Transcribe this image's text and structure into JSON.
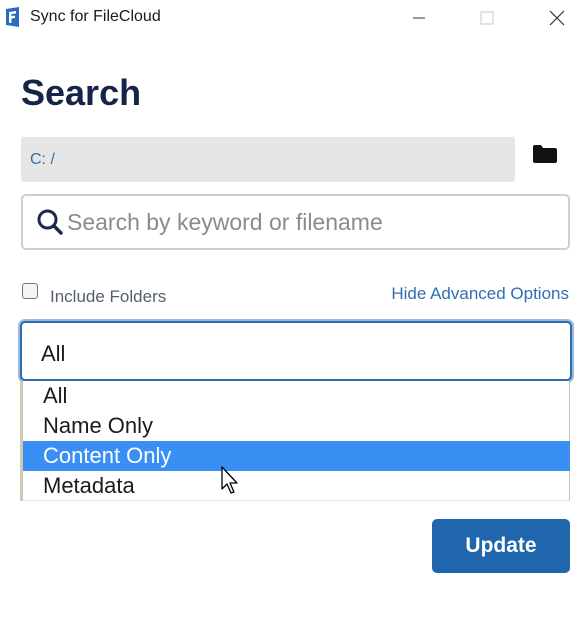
{
  "window": {
    "title": "Sync for FileCloud",
    "app_icon": "filecloud-logo",
    "controls": [
      "minimize-icon",
      "maximize-icon",
      "close-icon"
    ]
  },
  "page": {
    "title": "Search"
  },
  "path": {
    "value": "C: /",
    "browse_icon": "folder-icon"
  },
  "search": {
    "icon": "search-icon",
    "placeholder": "Search by keyword or filename",
    "value": ""
  },
  "options": {
    "include_folders_label": "Include Folders",
    "include_folders_checked": false,
    "advanced_link": "Hide Advanced Options"
  },
  "search_type": {
    "selected": "All",
    "items": [
      "All",
      "Name Only",
      "Content Only",
      "Metadata"
    ],
    "highlighted": "Content Only"
  },
  "actions": {
    "update_label": "Update"
  },
  "colors": {
    "accent": "#1f66ad",
    "link": "#2f6db4",
    "highlight": "#3a8ff5",
    "title": "#142548"
  }
}
